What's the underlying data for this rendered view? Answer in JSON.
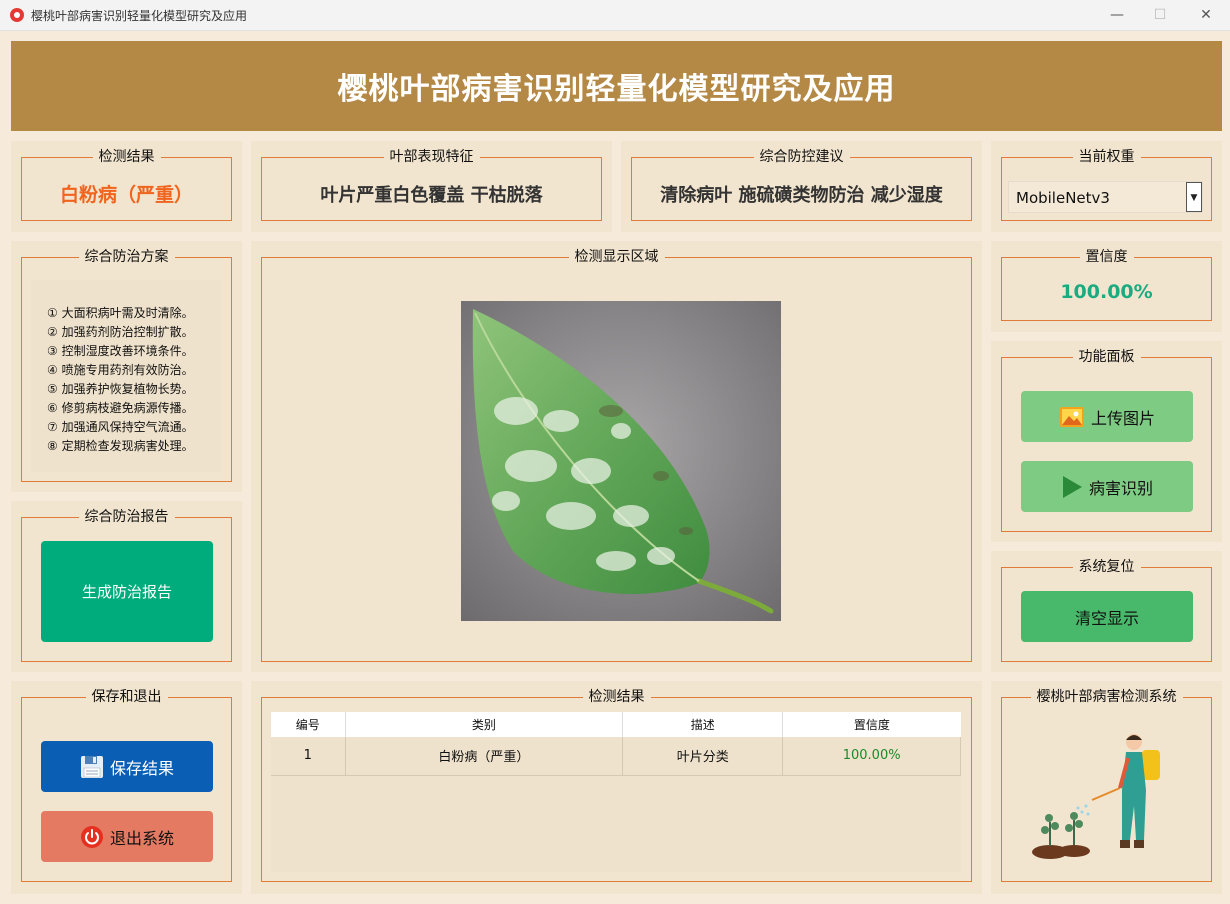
{
  "window": {
    "title": "樱桃叶部病害识别轻量化模型研究及应用",
    "minimize": "—",
    "maximize": "☐",
    "close": "✕"
  },
  "banner": {
    "title": "樱桃叶部病害识别轻量化模型研究及应用"
  },
  "detection": {
    "label": "检测结果",
    "value": "白粉病（严重）"
  },
  "features": {
    "label": "叶部表现特征",
    "value": "叶片严重白色覆盖 干枯脱落"
  },
  "advice": {
    "label": "综合防控建议",
    "value": "清除病叶 施硫磺类物防治 减少湿度"
  },
  "weights": {
    "label": "当前权重",
    "selected": "MobileNetv3"
  },
  "plan": {
    "label": "综合防治方案",
    "items": [
      "① 大面积病叶需及时清除。",
      "② 加强药剂防治控制扩散。",
      "③ 控制湿度改善环境条件。",
      "④ 喷施专用药剂有效防治。",
      "⑤ 加强养护恢复植物长势。",
      "⑥ 修剪病枝避免病源传播。",
      "⑦ 加强通风保持空气流通。",
      "⑧ 定期检查发现病害处理。"
    ]
  },
  "display": {
    "label": "检测显示区域"
  },
  "confidence": {
    "label": "置信度",
    "value": "100.00%"
  },
  "functions": {
    "label": "功能面板",
    "upload": "上传图片",
    "identify": "病害识别"
  },
  "report": {
    "label": "综合防治报告",
    "button": "生成防治报告"
  },
  "reset": {
    "label": "系统复位",
    "button": "清空显示"
  },
  "save_exit": {
    "label": "保存和退出",
    "save": "保存结果",
    "exit": "退出系统"
  },
  "results": {
    "label": "检测结果",
    "columns": [
      "编号",
      "类别",
      "描述",
      "置信度"
    ],
    "rows": [
      [
        "1",
        "白粉病（严重）",
        "叶片分类",
        "100.00%"
      ]
    ]
  },
  "brand": {
    "label": "樱桃叶部病害检测系统"
  },
  "colors": {
    "accent": "#b48945",
    "orange": "#e07b3a",
    "green": "#1aab80",
    "teal": "#00ac7c",
    "light_green": "#7ecb83",
    "mid_green": "#48b96a",
    "blue": "#0a5fb4",
    "red": "#e47a62"
  }
}
